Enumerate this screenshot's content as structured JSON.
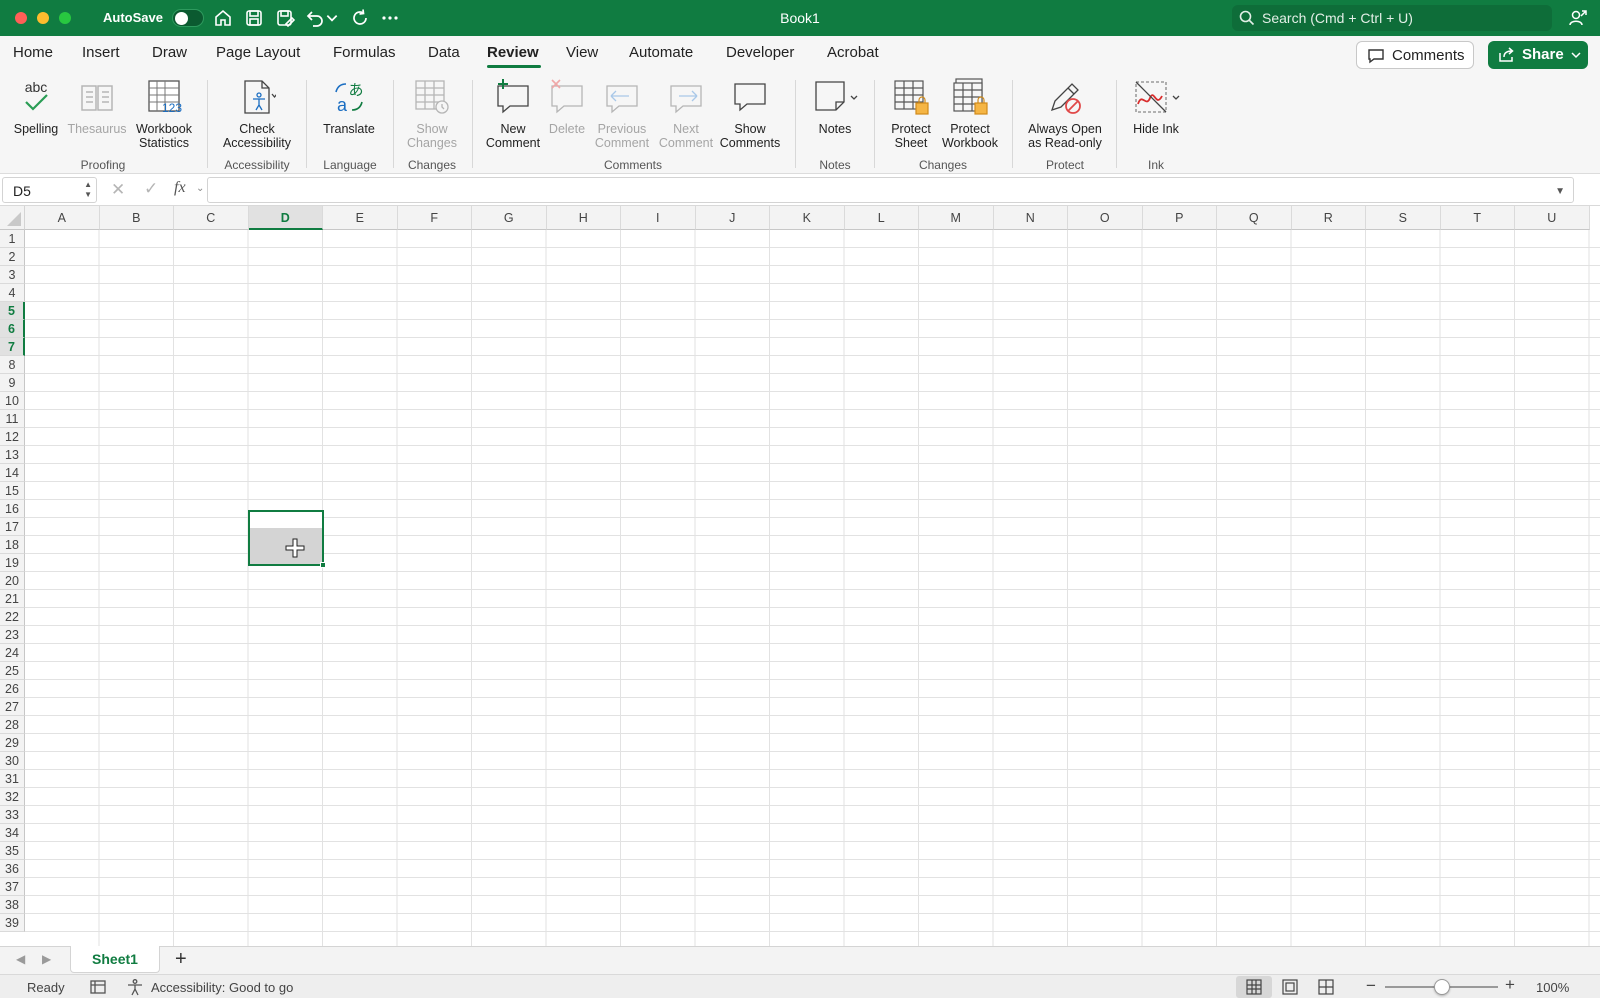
{
  "window": {
    "title": "Book1",
    "autosave_label": "AutoSave",
    "autosave_on": false,
    "search_placeholder": "Search (Cmd + Ctrl + U)"
  },
  "toolbar_icons": [
    "home-icon",
    "save-icon",
    "save-as-icon",
    "undo-icon",
    "undo-dropdown-icon",
    "redo-icon",
    "more-icon"
  ],
  "tabs": [
    {
      "label": "Home"
    },
    {
      "label": "Insert"
    },
    {
      "label": "Draw"
    },
    {
      "label": "Page Layout"
    },
    {
      "label": "Formulas"
    },
    {
      "label": "Data"
    },
    {
      "label": "Review",
      "active": true
    },
    {
      "label": "View"
    },
    {
      "label": "Automate"
    },
    {
      "label": "Developer"
    },
    {
      "label": "Acrobat"
    }
  ],
  "header_buttons": {
    "comments": "Comments",
    "share": "Share"
  },
  "ribbon": {
    "spelling": "Spelling",
    "thesaurus": "Thesaurus",
    "workbook_statistics_1": "Workbook",
    "workbook_statistics_2": "Statistics",
    "check_accessibility_1": "Check",
    "check_accessibility_2": "Accessibility",
    "translate": "Translate",
    "show_changes_1": "Show",
    "show_changes_2": "Changes",
    "new_comment_1": "New",
    "new_comment_2": "Comment",
    "delete": "Delete",
    "previous_comment_1": "Previous",
    "previous_comment_2": "Comment",
    "next_comment_1": "Next",
    "next_comment_2": "Comment",
    "show_comments_1": "Show",
    "show_comments_2": "Comments",
    "notes": "Notes",
    "protect_sheet_1": "Protect",
    "protect_sheet_2": "Sheet",
    "protect_workbook_1": "Protect",
    "protect_workbook_2": "Workbook",
    "always_open_1": "Always Open",
    "always_open_2": "as Read-only",
    "hide_ink": "Hide Ink",
    "groups": {
      "proofing": "Proofing",
      "accessibility": "Accessibility",
      "language": "Language",
      "changes": "Changes",
      "comments": "Comments",
      "notes": "Notes",
      "changes2": "Changes",
      "protect": "Protect",
      "ink": "Ink"
    }
  },
  "formula_bar": {
    "name_box": "D5",
    "fx": "fx",
    "formula": ""
  },
  "grid": {
    "columns": [
      "A",
      "B",
      "C",
      "D",
      "E",
      "F",
      "G",
      "H",
      "I",
      "J",
      "K",
      "L",
      "M",
      "N",
      "O",
      "P",
      "Q",
      "R",
      "S",
      "T",
      "U"
    ],
    "rows": [
      "1",
      "2",
      "3",
      "4",
      "5",
      "6",
      "7",
      "8",
      "9",
      "10",
      "11",
      "12",
      "13",
      "14",
      "15",
      "16",
      "17",
      "18",
      "19",
      "20",
      "21",
      "22",
      "23",
      "24",
      "25",
      "26",
      "27",
      "28",
      "29",
      "30",
      "31",
      "32",
      "33",
      "34",
      "35",
      "36",
      "37",
      "38",
      "39"
    ],
    "selected_column": "D",
    "selected_rows": [
      "5",
      "6",
      "7"
    ],
    "selection_range": "D5:D7"
  },
  "sheets": [
    {
      "label": "Sheet1",
      "active": true
    }
  ],
  "status": {
    "ready": "Ready",
    "accessibility": "Accessibility: Good to go",
    "zoom": "100%",
    "zoom_level": 1.0
  },
  "colors": {
    "accent": "#107c41",
    "titlebar": "#107c41"
  }
}
